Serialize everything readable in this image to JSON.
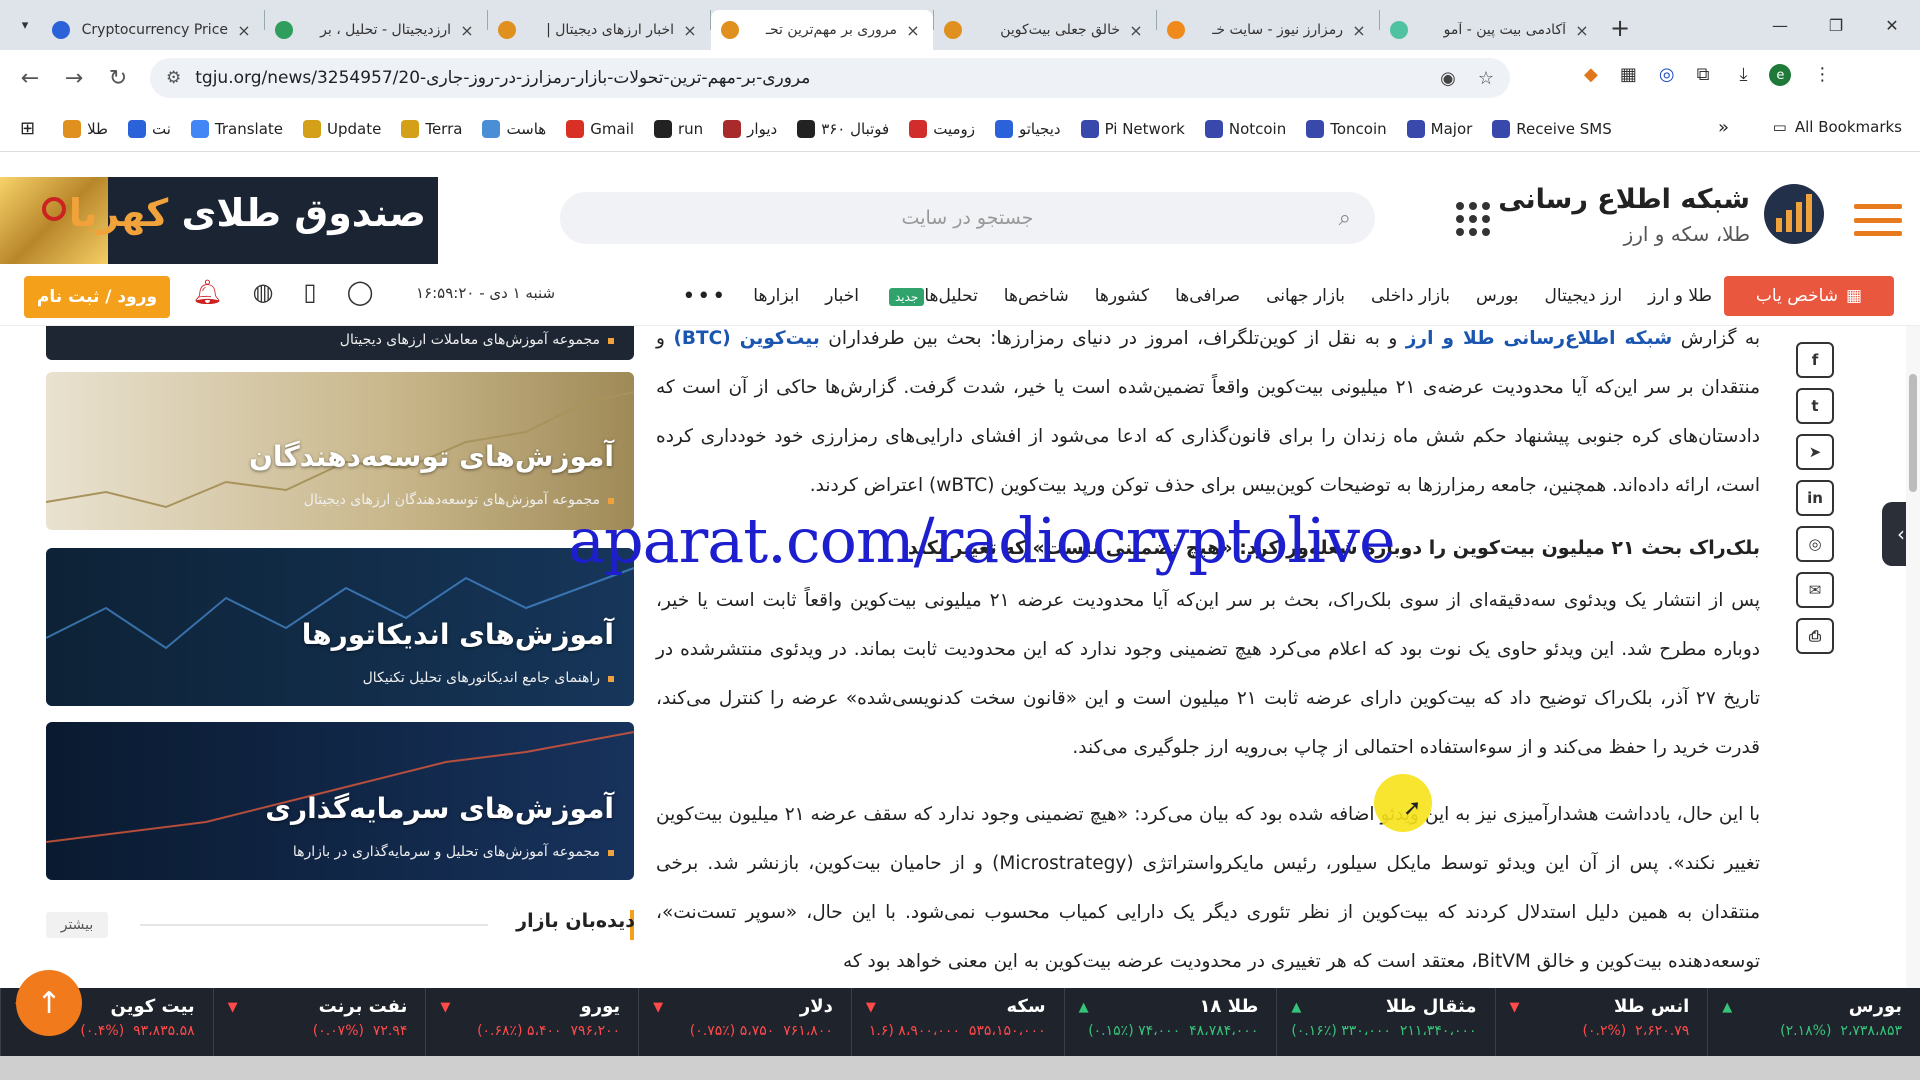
{
  "browser": {
    "tabs": [
      {
        "title": "Cryptocurrency Price",
        "fav_color": "#2b62d9",
        "active": false
      },
      {
        "title": "ارزدیجیتال - تحلیل ، بر",
        "fav_color": "#2f9d5c",
        "active": false
      },
      {
        "title": "اخبار ارزهای دیجیتال |",
        "fav_color": "#e0901e",
        "active": false
      },
      {
        "title": "مروری بر مهم‌ترین تحـ",
        "fav_color": "#e0901e",
        "active": true
      },
      {
        "title": "خالق جعلی بیت‌کوین",
        "fav_color": "#e0901e",
        "active": false
      },
      {
        "title": "رمزارز نیوز - سایت خـ",
        "fav_color": "#f08a1c",
        "active": false
      },
      {
        "title": "آکادمی بیت پین - آمو",
        "fav_color": "#4fc3a1",
        "active": false
      }
    ],
    "tab_close": "×",
    "new_tab": "+",
    "url": "tgju.org/news/3254957/20-مروری-بر-مهم-ترین-تحولات-بازار-رمزارز-در-روز-جاری",
    "profile_letter": "e"
  },
  "bookmarks": [
    {
      "label": "طلا",
      "color": "#e0901e"
    },
    {
      "label": "نت",
      "color": "#2b62d9"
    },
    {
      "label": "Translate",
      "color": "#4285f4"
    },
    {
      "label": "Update",
      "color": "#d4a017"
    },
    {
      "label": "Terra",
      "color": "#d4a017"
    },
    {
      "label": "هاست",
      "color": "#4a8fd6"
    },
    {
      "label": "Gmail",
      "color": "#d93025"
    },
    {
      "label": "run",
      "color": "#222"
    },
    {
      "label": "دیوار",
      "color": "#a82a2a"
    },
    {
      "label": "فوتبال ۳۶۰",
      "color": "#222"
    },
    {
      "label": "زومیت",
      "color": "#d12d2d"
    },
    {
      "label": "دیجیاتو",
      "color": "#2b62d9"
    },
    {
      "label": "Pi Network",
      "color": "#3949ab"
    },
    {
      "label": "Notcoin",
      "color": "#3949ab"
    },
    {
      "label": "Toncoin",
      "color": "#3949ab"
    },
    {
      "label": "Major",
      "color": "#3949ab"
    },
    {
      "label": "Receive SMS",
      "color": "#3949ab"
    }
  ],
  "bookmarks_more": "»",
  "all_bookmarks": "All Bookmarks",
  "site": {
    "brand_title": "شبکه اطلاع رسانی",
    "brand_subtitle": "طلا، سکه و ارز",
    "search_placeholder": "جستجو در سایت",
    "banner_text_1": "صندوق طلای",
    "banner_text_2": "کهربا",
    "shakhes_label": "شاخص یاب",
    "menu": [
      {
        "label": "طلا و ارز"
      },
      {
        "label": "ارز دیجیتال"
      },
      {
        "label": "بورس"
      },
      {
        "label": "بازار داخلی"
      },
      {
        "label": "بازار جهانی"
      },
      {
        "label": "صرافی‌ها"
      },
      {
        "label": "کشورها"
      },
      {
        "label": "شاخص‌ها"
      },
      {
        "label": "تحلیل‌ها"
      },
      {
        "label": "اخبار"
      },
      {
        "label": "ابزارها"
      }
    ],
    "new_badge": "جدید",
    "menu_more": "•••",
    "datetime": "شنبه ۱ دی - ۱۶:۵۹:۲۰",
    "login_label": "ورود / ثبت نام"
  },
  "cards": [
    {
      "title": "",
      "subtitle": "مجموعه آموزش‌های معاملات ارزهای دیجیتال"
    },
    {
      "title": "آموزش‌های توسعه‌دهندگان",
      "subtitle": "مجموعه آموزش‌های توسعه‌دهندگان ارزهای دیجیتال"
    },
    {
      "title": "آموزش‌های اندیکاتورها",
      "subtitle": "راهنمای جامع اندیکاتورهای تحلیل تکنیکال"
    },
    {
      "title": "آموزش‌های سرمایه‌گذاری",
      "subtitle": "مجموعه آموزش‌های تحلیل و سرمایه‌گذاری در بازارها"
    }
  ],
  "market_watch": {
    "title": "دیده‌بان بازار",
    "more": "بیشتر"
  },
  "article": {
    "p1_prefix": "به گزارش",
    "p1_link1": "شبکه اطلاع‌رسانی طلا و ارز",
    "p1_mid": "و به نقل از کوین‌تلگراف، امروز در دنیای رمزارزها: بحث بین طرفداران",
    "p1_link2": "بیت‌کوین (BTC)",
    "p1_rest": "و منتقدان بر سر این‌که آیا محدودیت عرضه‌ی ۲۱ میلیونی بیت‌کوین واقعاً تضمین‌شده است یا خیر، شدت گرفت. گزارش‌ها حاکی از آن است که دادستان‌های کره جنوبی پیشنهاد حکم شش ماه زندان را برای قانون‌گذاری که ادعا می‌شود از افشای دارایی‌های رمزارزی خود خودداری کرده است، ارائه داده‌اند. همچنین، جامعه رمزارزها به توضیحات کوین‌بیس برای حذف توکن ورپد بیت‌کوین (wBTC) اعتراض کردند.",
    "h1": "بلک‌راک بحث ۲۱ میلیون بیت‌کوین را دوباره شعله‌ور کرد: «هیچ تضمینی نیست» که تغییر نکند",
    "p2": "پس از انتشار یک ویدئوی سه‌دقیقه‌ای از سوی بلک‌راک، بحث بر سر این‌که آیا محدودیت عرضه ۲۱ میلیونی بیت‌کوین واقعاً ثابت است یا خیر، دوباره مطرح شد. این ویدئو حاوی یک نوت بود که اعلام می‌کرد هیچ تضمینی وجود ندارد که این محدودیت ثابت بماند. در ویدئوی منتشرشده در تاریخ ۲۷ آذر، بلک‌راک توضیح داد که بیت‌کوین دارای عرضه ثابت ۲۱ میلیون است و این «قانون سخت کدنویسی‌شده» عرضه را کنترل می‌کند، قدرت خرید را حفظ می‌کند و از سوءاستفاده احتمالی از چاپ بی‌رویه ارز جلوگیری می‌کند.",
    "p3": "با این حال، یادداشت هشدارآمیزی نیز به این ویدئو اضافه شده بود که بیان می‌کرد: «هیچ تضمینی وجود ندارد که سقف عرضه ۲۱ میلیون بیت‌کوین تغییر نکند». پس از آن این ویدئو توسط مایکل سیلور، رئیس مایکرواستراتژی (Microstrategy) و از حامیان بیت‌کوین، بازنشر شد. برخی منتقدان به همین دلیل استدلال کردند که بیت‌کوین از نظر تئوری دیگر یک دارایی کمیاب محسوب نمی‌شود. با این حال، «سوپر تست‌نت»، توسعه‌دهنده بیت‌کوین و خالق BitVM، معتقد است که هر تغییری در محدودیت عرضه بیت‌کوین به این معنی خواهد بود که"
  },
  "watermark": "aparat.com/radiocryptolive",
  "ticker": [
    {
      "name": "بورس",
      "value": "۲،۷۳۸،۸۵۳",
      "change": "(۲.۱۸%)",
      "dir": "up"
    },
    {
      "name": "انس طلا",
      "value": "۲،۶۲۰.۷۹",
      "change": "(۰.۲%)",
      "dir": "dn"
    },
    {
      "name": "مثقال طلا",
      "value": "۲۱۱،۳۴۰،۰۰۰",
      "change": "۳۳۰،۰۰۰ (۰.۱۶٪)",
      "dir": "up"
    },
    {
      "name": "طلا ۱۸",
      "value": "۴۸،۷۸۴،۰۰۰",
      "change": "۷۴،۰۰۰ (۰.۱۵٪)",
      "dir": "up"
    },
    {
      "name": "سکه",
      "value": "۵۳۵،۱۵۰،۰۰۰",
      "change": "۸،۹۰۰،۰۰۰ (۱.۶",
      "dir": "dn"
    },
    {
      "name": "دلار",
      "value": "۷۶۱،۸۰۰",
      "change": "۵،۷۵۰ (۰.۷۵٪)",
      "dir": "dn"
    },
    {
      "name": "یورو",
      "value": "۷۹۶،۲۰۰",
      "change": "۵،۴۰۰ (۰.۶۸٪)",
      "dir": "dn"
    },
    {
      "name": "نفت برنت",
      "value": "۷۲.۹۴",
      "change": "(۰.۰۷%)",
      "dir": "dn"
    },
    {
      "name": "بیت کوین",
      "value": "۹۳،۸۳۵.۵۸",
      "change": "(۰.۴%)",
      "dir": "dn"
    }
  ]
}
